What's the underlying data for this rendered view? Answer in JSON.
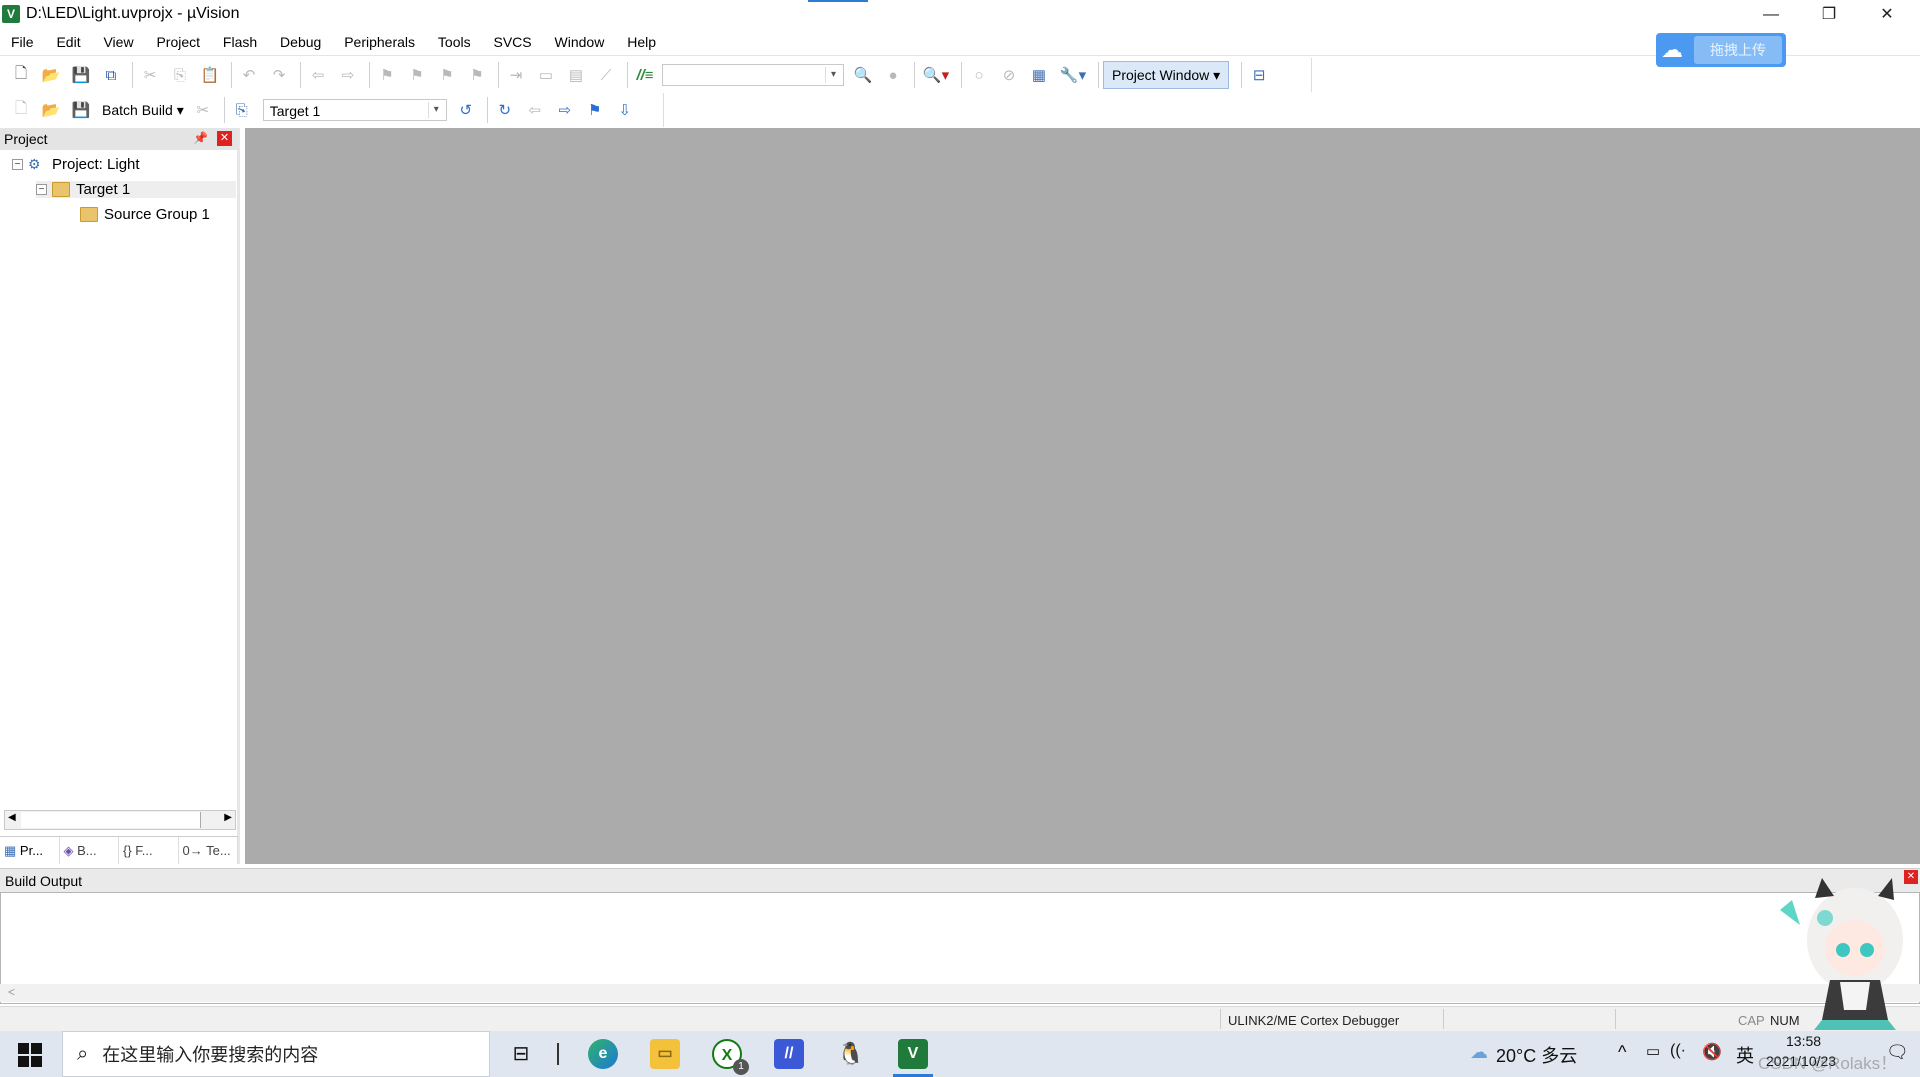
{
  "window": {
    "title": "D:\\LED\\Light.uvprojx - µVision",
    "app_icon": "V",
    "controls": [
      "—",
      "❐",
      "✕"
    ]
  },
  "menu": [
    "File",
    "Edit",
    "View",
    "Project",
    "Flash",
    "Debug",
    "Peripherals",
    "Tools",
    "SVCS",
    "Window",
    "Help"
  ],
  "toolbar1": {
    "project_window_label": "Project Window",
    "find_combo_value": ""
  },
  "toolbar2": {
    "batch_build_label": "Batch Build",
    "target_combo_value": "Target 1"
  },
  "baidu": {
    "label": "拖拽上传"
  },
  "project_panel": {
    "title": "Project",
    "tree": [
      {
        "label": "Project: Light",
        "level": 0,
        "toggle": "−"
      },
      {
        "label": "Target 1",
        "level": 1,
        "toggle": "−"
      },
      {
        "label": "Source Group 1",
        "level": 2,
        "toggle": ""
      }
    ],
    "tabs": [
      "Pr...",
      "B...",
      "{} F...",
      "0→ Te..."
    ]
  },
  "build_output": {
    "title": "Build Output",
    "content": ""
  },
  "statusbar": {
    "debugger": "ULINK2/ME Cortex Debugger",
    "cap": "CAP",
    "num": "NUM"
  },
  "taskbar": {
    "search_placeholder": "在这里输入你要搜索的内容",
    "weather": "20°C 多云",
    "ime": "英",
    "time": "13:58",
    "date": "2021/10/23",
    "xbox_badge": "1"
  },
  "watermark": "CSDN @Rolaks！",
  "colors": {
    "editor_bg": "#ababab",
    "accent": "#4b99f0",
    "keil_green": "#1f7a3c"
  }
}
